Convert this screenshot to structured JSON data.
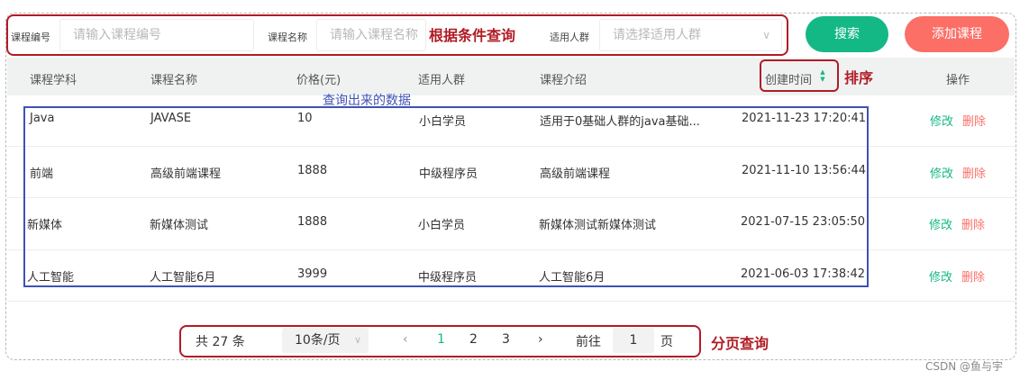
{
  "search": {
    "course_code_label": "课程编号",
    "course_code_placeholder": "请输入课程编号",
    "course_name_label": "课程名称",
    "course_name_placeholder": "请输入课程名称",
    "audience_label": "适用人群",
    "audience_placeholder": "请选择适用人群",
    "search_button": "搜索",
    "add_button": "添加课程"
  },
  "annotations": {
    "search": "根据条件查询",
    "sort": "排序",
    "data": "查询出来的数据",
    "pagination": "分页查询"
  },
  "table": {
    "headers": [
      "课程学科",
      "课程名称",
      "价格(元)",
      "适用人群",
      "课程介绍",
      "创建时间",
      "操作"
    ],
    "rows": [
      {
        "subject": "Java",
        "name": "JAVASE",
        "price": "10",
        "audience": "小白学员",
        "intro": "适用于0基础人群的java基础...",
        "created": "2021-11-23 17:20:41",
        "edit": "修改",
        "delete": "删除"
      },
      {
        "subject": "前端",
        "name": "高级前端课程",
        "price": "1888",
        "audience": "中级程序员",
        "intro": "高级前端课程",
        "created": "2021-11-10 13:56:44",
        "edit": "修改",
        "delete": "删除"
      },
      {
        "subject": "新媒体",
        "name": "新媒体测试",
        "price": "1888",
        "audience": "小白学员",
        "intro": "新媒体测试新媒体测试",
        "created": "2021-07-15 23:05:50",
        "edit": "修改",
        "delete": "删除"
      },
      {
        "subject": "人工智能",
        "name": "人工智能6月",
        "price": "3999",
        "audience": "中级程序员",
        "intro": "人工智能6月",
        "created": "2021-06-03 17:38:42",
        "edit": "修改",
        "delete": "删除"
      }
    ]
  },
  "pagination": {
    "total": "共 27 条",
    "page_size": "10条/页",
    "prev": "‹",
    "pages": [
      "1",
      "2",
      "3"
    ],
    "current_page": "1",
    "next": "›",
    "goto_label": "前往",
    "goto_value": "1",
    "goto_suffix": "页"
  },
  "watermark": "CSDN @鱼与宇",
  "colors": {
    "accent_green": "#14b885",
    "accent_red": "#fb6f67",
    "annotation_red": "#b01c25",
    "annotation_blue": "#3f51b5"
  }
}
